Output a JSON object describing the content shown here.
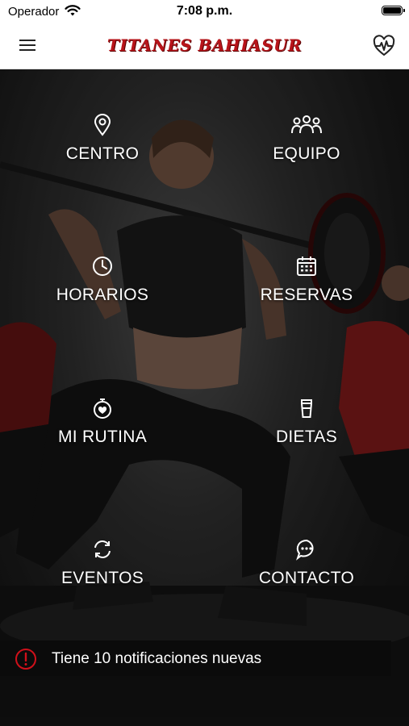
{
  "status_bar": {
    "carrier": "Operador",
    "time": "7:08 p.m."
  },
  "nav": {
    "title": "TITANES BAHIASUR",
    "menu_icon": "hamburger-menu-icon",
    "right_icon": "heart-pulse-icon",
    "title_color": "#b8141a"
  },
  "menu": {
    "centro": {
      "label": "CENTRO",
      "icon": "map-pin-icon"
    },
    "equipo": {
      "label": "EQUIPO",
      "icon": "group-icon"
    },
    "horarios": {
      "label": "HORARIOS",
      "icon": "clock-icon"
    },
    "reservas": {
      "label": "RESERVAS",
      "icon": "calendar-icon"
    },
    "rutina": {
      "label": "MI RUTINA",
      "icon": "stopwatch-heart-icon"
    },
    "dietas": {
      "label": "DIETAS",
      "icon": "shaker-icon"
    },
    "eventos": {
      "label": "EVENTOS",
      "icon": "refresh-icon"
    },
    "contacto": {
      "label": "CONTACTO",
      "icon": "chat-bubble-icon"
    }
  },
  "notification": {
    "text": "Tiene 10 notificaciones nuevas",
    "icon": "alert-circle-icon",
    "accent": "#d0101a"
  }
}
